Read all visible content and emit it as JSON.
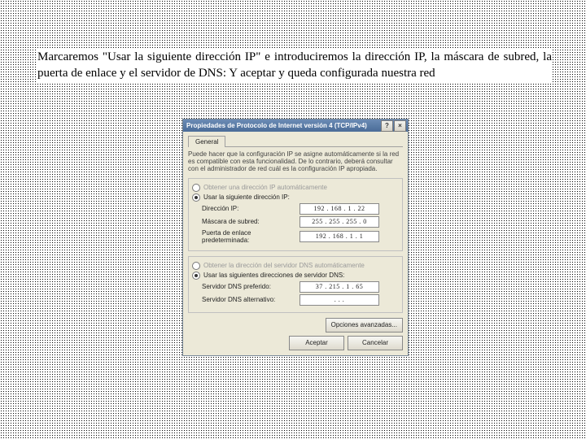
{
  "instruction": "Marcaremos \"Usar la siguiente dirección IP\" e introduciremos la dirección IP, la máscara de subred, la puerta de enlace y el servidor de DNS: Y aceptar y queda configurada nuestra red",
  "dialog": {
    "title": "Propiedades de Protocolo de Internet versión 4 (TCP/IPv4)",
    "help_btn": "?",
    "close_btn": "×",
    "tab_general": "General",
    "description": "Puede hacer que la configuración IP se asigne automáticamente si la red es compatible con esta funcionalidad. De lo contrario, deberá consultar con el administrador de red cuál es la configuración IP apropiada.",
    "radio_auto_ip": "Obtener una dirección IP automáticamente",
    "radio_static_ip": "Usar la siguiente dirección IP:",
    "lbl_ip": "Dirección IP:",
    "val_ip": "192 . 168 .  1  . 22",
    "lbl_mask": "Máscara de subred:",
    "val_mask": "255 . 255 . 255 .  0",
    "lbl_gw": "Puerta de enlace predeterminada:",
    "val_gw": "192 . 168 .  1  .  1",
    "radio_auto_dns": "Obtener la dirección del servidor DNS automáticamente",
    "radio_static_dns": "Usar las siguientes direcciones de servidor DNS:",
    "lbl_dns1": "Servidor DNS preferido:",
    "val_dns1": " 37 . 215 .  1  . 65",
    "lbl_dns2": "Servidor DNS alternativo:",
    "val_dns2": "   .    .    .   ",
    "btn_advanced": "Opciones avanzadas...",
    "btn_ok": "Aceptar",
    "btn_cancel": "Cancelar"
  }
}
